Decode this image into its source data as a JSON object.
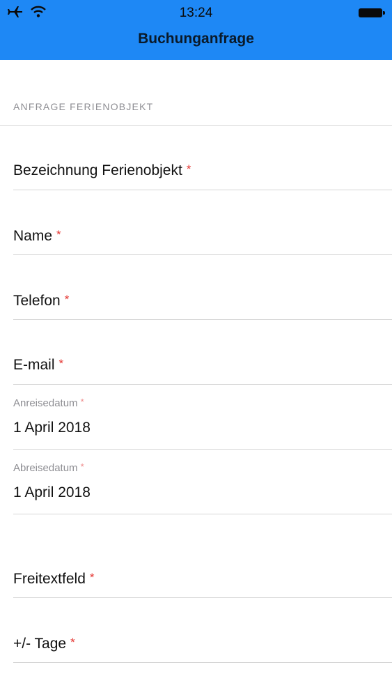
{
  "status_bar": {
    "time": "13:24"
  },
  "nav": {
    "title": "Buchunganfrage"
  },
  "section": {
    "header": "ANFRAGE FERIENOBJEKT"
  },
  "required_marker": "*",
  "fields": {
    "bezeichnung": {
      "label": "Bezeichnung Ferienobjekt"
    },
    "name": {
      "label": "Name"
    },
    "telefon": {
      "label": "Telefon"
    },
    "email": {
      "label": "E-mail"
    },
    "anreise": {
      "label": "Anreisedatum",
      "value": "1 April 2018"
    },
    "abreise": {
      "label": "Abreisedatum",
      "value": "1 April 2018"
    },
    "freitext": {
      "label": "Freitextfeld"
    },
    "tage": {
      "label": "+/- Tage"
    }
  },
  "colors": {
    "nav_bar": "#1e88f5",
    "required": "#e53935"
  }
}
